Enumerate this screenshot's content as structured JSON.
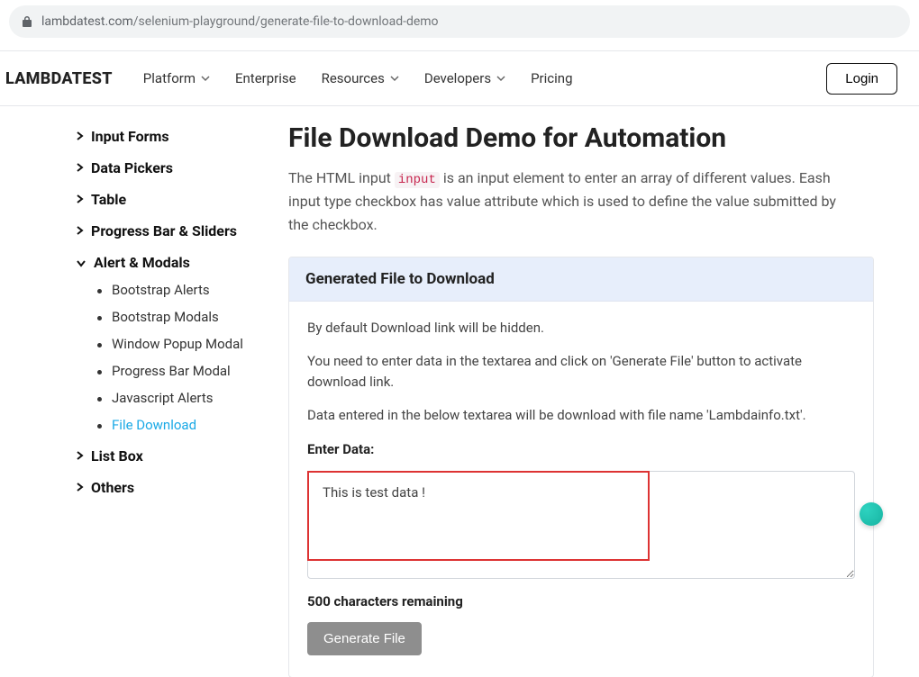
{
  "url": {
    "host": "lambdatest.com",
    "path": "/selenium-playground/generate-file-to-download-demo"
  },
  "brand": "LAMBDATEST",
  "nav": {
    "items": [
      {
        "label": "Platform",
        "has_caret": true
      },
      {
        "label": "Enterprise",
        "has_caret": false
      },
      {
        "label": "Resources",
        "has_caret": true
      },
      {
        "label": "Developers",
        "has_caret": true
      },
      {
        "label": "Pricing",
        "has_caret": false
      }
    ],
    "login": "Login"
  },
  "sidebar": [
    {
      "label": "Input Forms",
      "expanded": false,
      "items": []
    },
    {
      "label": "Data Pickers",
      "expanded": false,
      "items": []
    },
    {
      "label": "Table",
      "expanded": false,
      "items": []
    },
    {
      "label": "Progress Bar & Sliders",
      "expanded": false,
      "items": []
    },
    {
      "label": "Alert & Modals",
      "expanded": true,
      "items": [
        {
          "label": "Bootstrap Alerts",
          "active": false
        },
        {
          "label": "Bootstrap Modals",
          "active": false
        },
        {
          "label": "Window Popup Modal",
          "active": false
        },
        {
          "label": "Progress Bar Modal",
          "active": false
        },
        {
          "label": "Javascript Alerts",
          "active": false
        },
        {
          "label": "File Download",
          "active": true
        }
      ]
    },
    {
      "label": "List Box",
      "expanded": false,
      "items": []
    },
    {
      "label": "Others",
      "expanded": false,
      "items": []
    }
  ],
  "page": {
    "title": "File Download Demo for Automation",
    "intro_before": "The HTML input ",
    "intro_code": "input",
    "intro_after": " is an input element to enter an array of different values. Eash input type checkbox has value attribute which is used to define the value submitted by the checkbox.",
    "panel_header": "Generated File to Download",
    "instructions": [
      "By default Download link will be hidden.",
      "You need to enter data in the textarea and click on 'Generate File' button to activate download link.",
      "Data entered in the below textarea will be download with file name 'Lambdainfo.txt'."
    ],
    "textarea_label": "Enter Data:",
    "textarea_value": "This is test data !",
    "remaining": "500 characters remaining",
    "generate_button": "Generate File"
  }
}
